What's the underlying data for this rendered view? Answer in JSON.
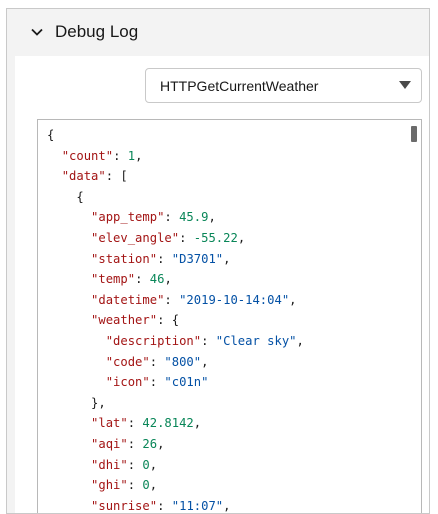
{
  "panel": {
    "title": "Debug Log",
    "icon": "chevron-down-icon"
  },
  "request_select": {
    "value": "HTTPGetCurrentWeather",
    "icon": "caret-down-icon"
  },
  "json_lines": [
    [
      {
        "t": "p",
        "v": "{"
      }
    ],
    [
      {
        "t": "p",
        "v": "  "
      },
      {
        "t": "k",
        "v": "\"count\""
      },
      {
        "t": "p",
        "v": ": "
      },
      {
        "t": "n",
        "v": "1"
      },
      {
        "t": "p",
        "v": ","
      }
    ],
    [
      {
        "t": "p",
        "v": "  "
      },
      {
        "t": "k",
        "v": "\"data\""
      },
      {
        "t": "p",
        "v": ": ["
      }
    ],
    [
      {
        "t": "p",
        "v": "    {"
      }
    ],
    [
      {
        "t": "p",
        "v": "      "
      },
      {
        "t": "k",
        "v": "\"app_temp\""
      },
      {
        "t": "p",
        "v": ": "
      },
      {
        "t": "n",
        "v": "45.9"
      },
      {
        "t": "p",
        "v": ","
      }
    ],
    [
      {
        "t": "p",
        "v": "      "
      },
      {
        "t": "k",
        "v": "\"elev_angle\""
      },
      {
        "t": "p",
        "v": ": "
      },
      {
        "t": "n",
        "v": "-55.22"
      },
      {
        "t": "p",
        "v": ","
      }
    ],
    [
      {
        "t": "p",
        "v": "      "
      },
      {
        "t": "k",
        "v": "\"station\""
      },
      {
        "t": "p",
        "v": ": "
      },
      {
        "t": "s",
        "v": "\"D3701\""
      },
      {
        "t": "p",
        "v": ","
      }
    ],
    [
      {
        "t": "p",
        "v": "      "
      },
      {
        "t": "k",
        "v": "\"temp\""
      },
      {
        "t": "p",
        "v": ": "
      },
      {
        "t": "n",
        "v": "46"
      },
      {
        "t": "p",
        "v": ","
      }
    ],
    [
      {
        "t": "p",
        "v": "      "
      },
      {
        "t": "k",
        "v": "\"datetime\""
      },
      {
        "t": "p",
        "v": ": "
      },
      {
        "t": "s",
        "v": "\"2019-10-14:04\""
      },
      {
        "t": "p",
        "v": ","
      }
    ],
    [
      {
        "t": "p",
        "v": "      "
      },
      {
        "t": "k",
        "v": "\"weather\""
      },
      {
        "t": "p",
        "v": ": {"
      }
    ],
    [
      {
        "t": "p",
        "v": "        "
      },
      {
        "t": "k",
        "v": "\"description\""
      },
      {
        "t": "p",
        "v": ": "
      },
      {
        "t": "s",
        "v": "\"Clear sky\""
      },
      {
        "t": "p",
        "v": ","
      }
    ],
    [
      {
        "t": "p",
        "v": "        "
      },
      {
        "t": "k",
        "v": "\"code\""
      },
      {
        "t": "p",
        "v": ": "
      },
      {
        "t": "s",
        "v": "\"800\""
      },
      {
        "t": "p",
        "v": ","
      }
    ],
    [
      {
        "t": "p",
        "v": "        "
      },
      {
        "t": "k",
        "v": "\"icon\""
      },
      {
        "t": "p",
        "v": ": "
      },
      {
        "t": "s",
        "v": "\"c01n\""
      }
    ],
    [
      {
        "t": "p",
        "v": "      },"
      }
    ],
    [
      {
        "t": "p",
        "v": "      "
      },
      {
        "t": "k",
        "v": "\"lat\""
      },
      {
        "t": "p",
        "v": ": "
      },
      {
        "t": "n",
        "v": "42.8142"
      },
      {
        "t": "p",
        "v": ","
      }
    ],
    [
      {
        "t": "p",
        "v": "      "
      },
      {
        "t": "k",
        "v": "\"aqi\""
      },
      {
        "t": "p",
        "v": ": "
      },
      {
        "t": "n",
        "v": "26"
      },
      {
        "t": "p",
        "v": ","
      }
    ],
    [
      {
        "t": "p",
        "v": "      "
      },
      {
        "t": "k",
        "v": "\"dhi\""
      },
      {
        "t": "p",
        "v": ": "
      },
      {
        "t": "n",
        "v": "0"
      },
      {
        "t": "p",
        "v": ","
      }
    ],
    [
      {
        "t": "p",
        "v": "      "
      },
      {
        "t": "k",
        "v": "\"ghi\""
      },
      {
        "t": "p",
        "v": ": "
      },
      {
        "t": "n",
        "v": "0"
      },
      {
        "t": "p",
        "v": ","
      }
    ],
    [
      {
        "t": "p",
        "v": "      "
      },
      {
        "t": "k",
        "v": "\"sunrise\""
      },
      {
        "t": "p",
        "v": ": "
      },
      {
        "t": "s",
        "v": "\"11:07\""
      },
      {
        "t": "p",
        "v": ","
      }
    ]
  ],
  "colors": {
    "key": "#a31515",
    "string": "#0451a5",
    "number": "#098658"
  }
}
